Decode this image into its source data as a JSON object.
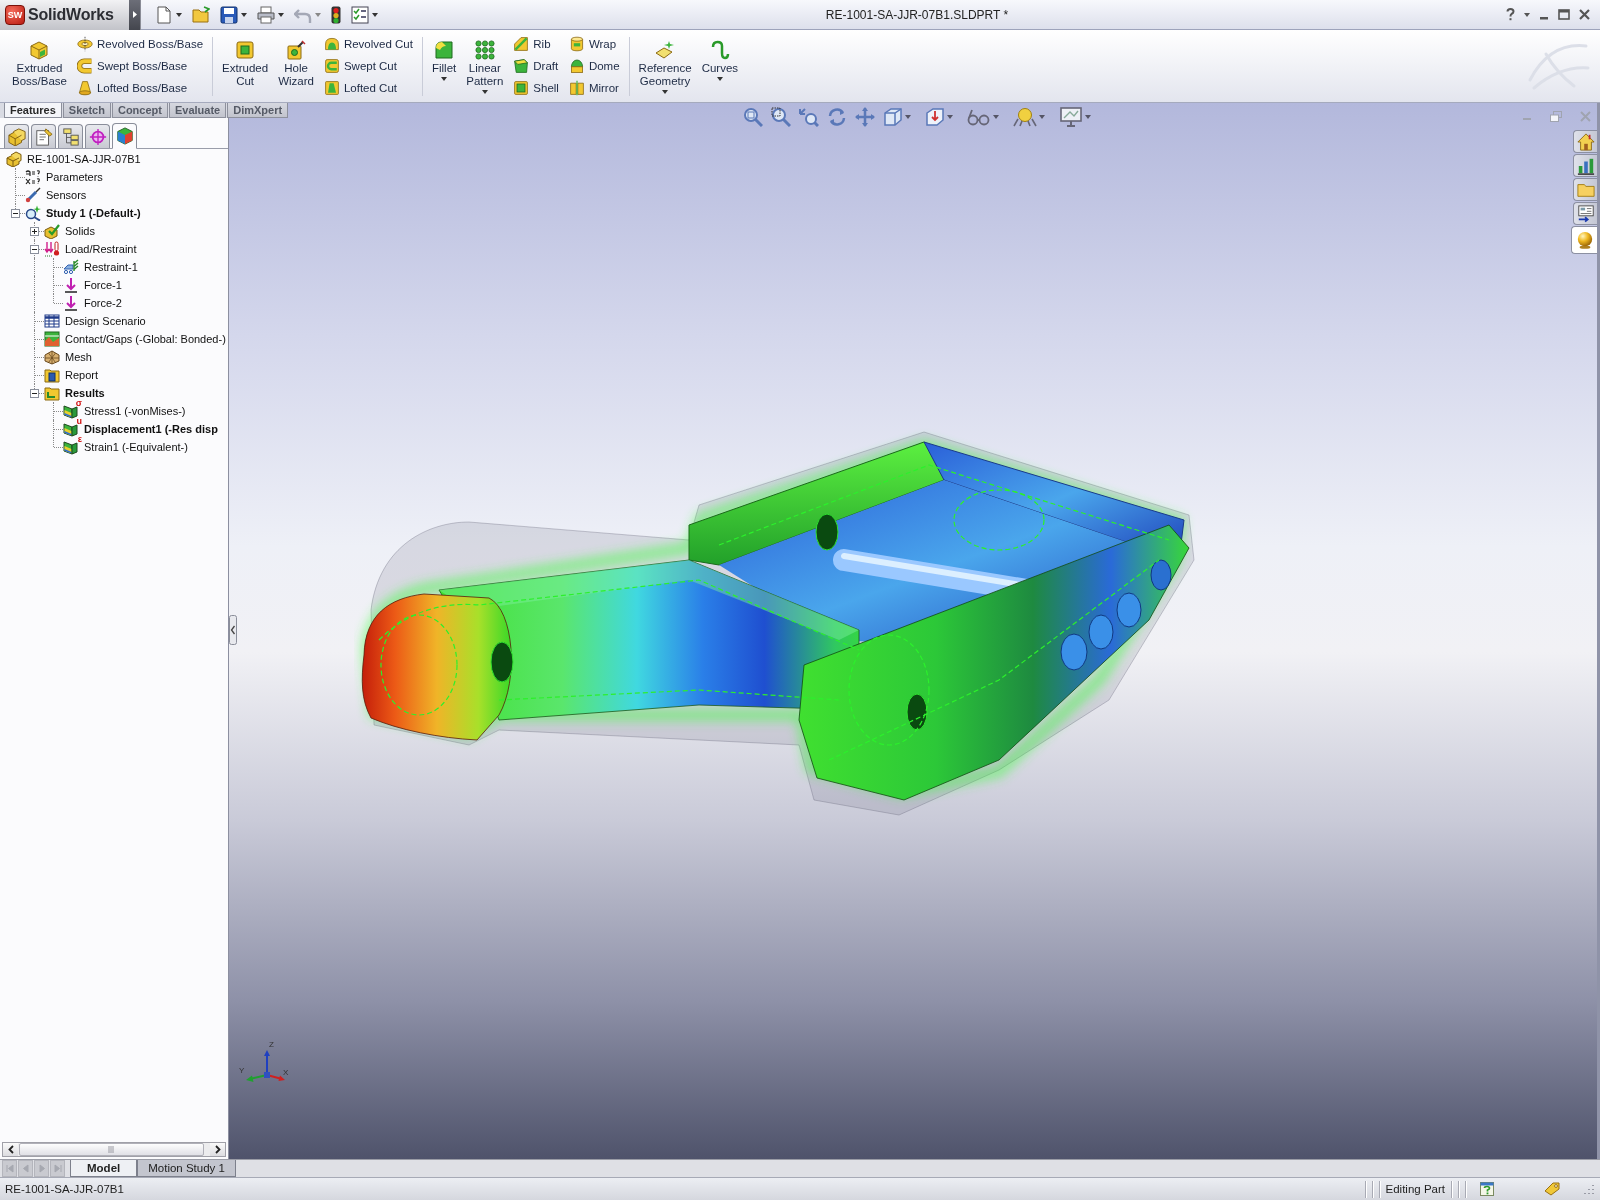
{
  "window": {
    "logo_mark": "SW",
    "app_name": "SolidWorks",
    "title": "RE-1001-SA-JJR-07B1.SLDPRT *"
  },
  "command_manager": {
    "groups": [
      {
        "large": [
          {
            "label": "Extruded Boss/Base",
            "kind": "extrude",
            "dropdown": false
          }
        ],
        "columns": [
          [
            {
              "label": "Revolved Boss/Base",
              "kind": "revolve"
            },
            {
              "label": "Swept Boss/Base",
              "kind": "sweep"
            },
            {
              "label": "Lofted Boss/Base",
              "kind": "loft"
            }
          ]
        ]
      },
      {
        "large": [
          {
            "label": "Extruded Cut",
            "kind": "extrude-cut",
            "dropdown": false
          },
          {
            "label": "Hole Wizard",
            "kind": "hole",
            "dropdown": false
          }
        ],
        "columns": [
          [
            {
              "label": "Revolved Cut",
              "kind": "revolve-cut"
            },
            {
              "label": "Swept Cut",
              "kind": "sweep-cut"
            },
            {
              "label": "Lofted Cut",
              "kind": "loft-cut"
            }
          ]
        ]
      },
      {
        "large": [
          {
            "label": "Fillet",
            "kind": "fillet",
            "dropdown": true
          },
          {
            "label": "Linear Pattern",
            "kind": "pattern",
            "dropdown": true
          }
        ],
        "columns": [
          [
            {
              "label": "Rib",
              "kind": "rib"
            },
            {
              "label": "Draft",
              "kind": "draft"
            },
            {
              "label": "Shell",
              "kind": "shell"
            }
          ],
          [
            {
              "label": "Wrap",
              "kind": "wrap"
            },
            {
              "label": "Dome",
              "kind": "dome"
            },
            {
              "label": "Mirror",
              "kind": "mirror"
            }
          ]
        ]
      },
      {
        "large": [
          {
            "label": "Reference Geometry",
            "kind": "reference",
            "dropdown": true
          },
          {
            "label": "Curves",
            "kind": "curve",
            "dropdown": true
          }
        ]
      }
    ],
    "tabs": [
      {
        "label": "Features",
        "selected": true
      },
      {
        "label": "Sketch",
        "selected": false
      },
      {
        "label": "Concept",
        "selected": false
      },
      {
        "label": "Evaluate",
        "selected": false
      },
      {
        "label": "DimXpert",
        "selected": false
      }
    ]
  },
  "feature_manager": {
    "tabs": [
      {
        "kind": "feature-tree",
        "selected": false
      },
      {
        "kind": "property",
        "selected": false
      },
      {
        "kind": "configuration",
        "selected": false
      },
      {
        "kind": "dimxpert",
        "selected": false
      },
      {
        "kind": "simulation",
        "selected": true
      }
    ],
    "tree": {
      "label": "RE-1001-SA-JJR-07B1",
      "kind": "part",
      "active": false,
      "children": [
        {
          "label": "Parameters",
          "kind": "parameters",
          "active": false
        },
        {
          "label": "Sensors",
          "kind": "sensors",
          "active": false
        },
        {
          "label": "Study 1 (-Default-)",
          "kind": "study",
          "active": true,
          "expanded": true,
          "children": [
            {
              "label": "Solids",
              "kind": "solids",
              "active": false,
              "expanded": false
            },
            {
              "label": "Load/Restraint",
              "kind": "loads",
              "active": false,
              "expanded": true,
              "children": [
                {
                  "label": "Restraint-1",
                  "kind": "restraint",
                  "active": false
                },
                {
                  "label": "Force-1",
                  "kind": "force",
                  "active": false
                },
                {
                  "label": "Force-2",
                  "kind": "force",
                  "active": false
                }
              ]
            },
            {
              "label": "Design Scenario",
              "kind": "scenario",
              "active": false
            },
            {
              "label": "Contact/Gaps (-Global: Bonded-)",
              "kind": "contact",
              "active": false
            },
            {
              "label": "Mesh",
              "kind": "mesh",
              "active": false
            },
            {
              "label": "Report",
              "kind": "report",
              "active": false
            },
            {
              "label": "Results",
              "kind": "folder",
              "active": true,
              "expanded": true,
              "children": [
                {
                  "label": "Stress1 (-vonMises-)",
                  "kind": "result",
                  "symbol": "σ",
                  "active": false
                },
                {
                  "label": "Displacement1 (-Res disp",
                  "kind": "result",
                  "symbol": "u",
                  "active": true
                },
                {
                  "label": "Strain1 (-Equivalent-)",
                  "kind": "result",
                  "symbol": "ε",
                  "active": false
                }
              ]
            }
          ]
        }
      ]
    }
  },
  "viewport": {
    "triad": {
      "z_label": "Z",
      "y_label": "Y",
      "x_label": "X"
    }
  },
  "task_pane": {
    "tabs": [
      {
        "kind": "home",
        "selected": false
      },
      {
        "kind": "resources",
        "selected": false
      },
      {
        "kind": "library",
        "selected": false
      },
      {
        "kind": "explorer",
        "selected": false
      },
      {
        "kind": "appearance",
        "selected": true
      }
    ]
  },
  "bottom_tabs": [
    {
      "label": "Model",
      "selected": true
    },
    {
      "label": "Motion Study 1",
      "selected": false
    }
  ],
  "status_bar": {
    "document": "RE-1001-SA-JJR-07B1",
    "mode": "Editing Part"
  }
}
